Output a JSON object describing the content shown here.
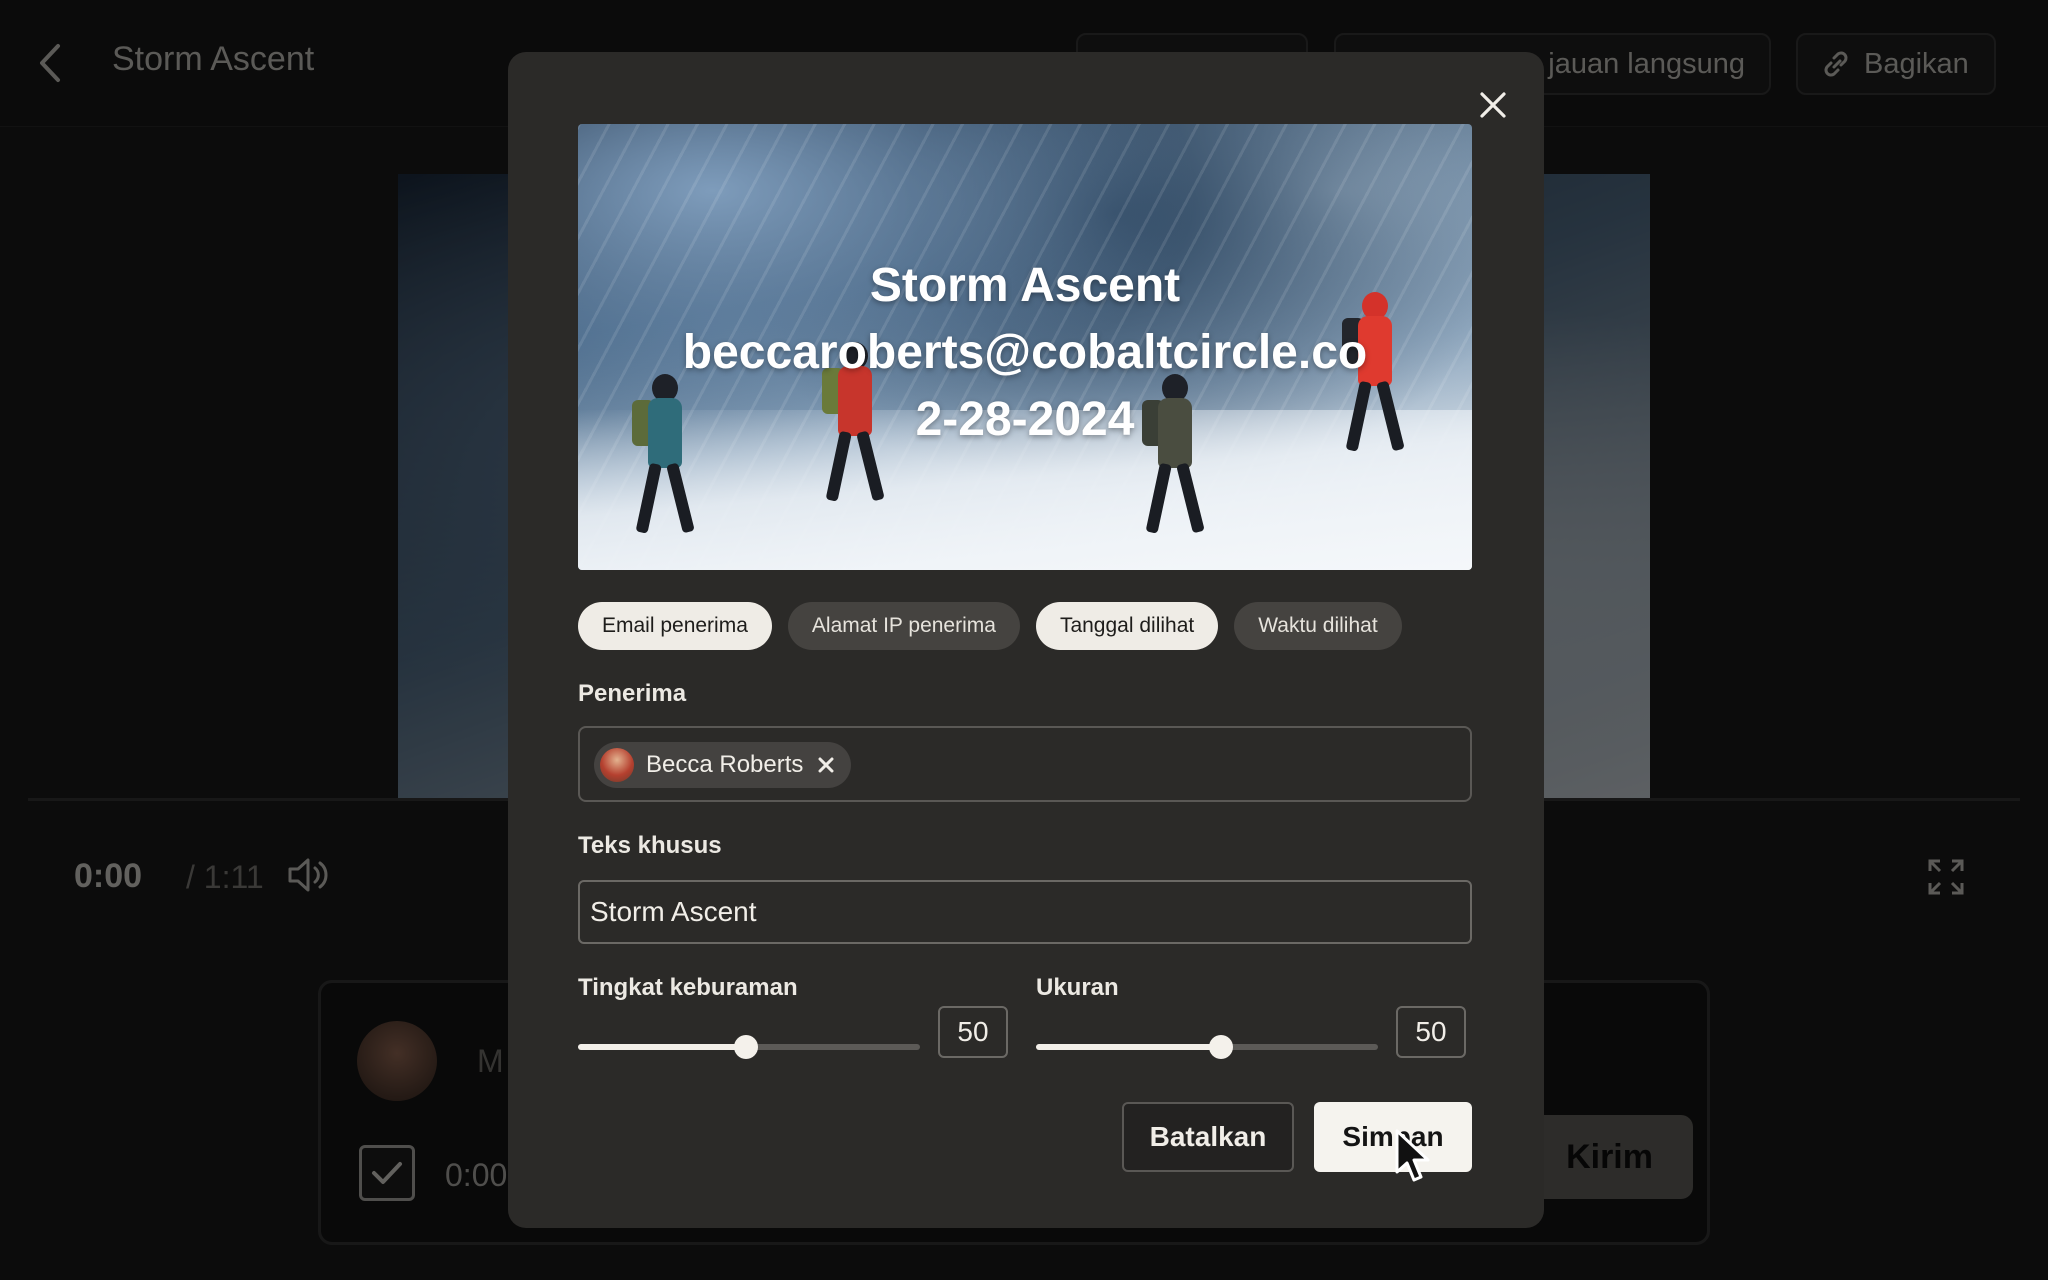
{
  "app": {
    "title": "Storm Ascent",
    "header_buttons": {
      "versions_label": "",
      "live_review_label": "jauan langsung",
      "share_label": "Bagikan"
    }
  },
  "player": {
    "time_current": "0:00",
    "time_total": "/ 1:11"
  },
  "comment": {
    "placeholder": "M",
    "timestamp": "0:00",
    "send_label": "Kirim"
  },
  "modal": {
    "preview": {
      "title": "Storm Ascent",
      "email": "beccaroberts@cobaltcircle.co",
      "date": "2-28-2024"
    },
    "chips": [
      {
        "label": "Email penerima",
        "selected": true
      },
      {
        "label": "Alamat IP penerima",
        "selected": false
      },
      {
        "label": "Tanggal dilihat",
        "selected": true
      },
      {
        "label": "Waktu dilihat",
        "selected": false
      }
    ],
    "recipient_label": "Penerima",
    "recipient_name": "Becca Roberts",
    "custom_text_label": "Teks khusus",
    "custom_text_value": "Storm Ascent",
    "blur_label": "Tingkat keburaman",
    "blur_value": "50",
    "blur_fraction": 0.49,
    "size_label": "Ukuran",
    "size_value": "50",
    "size_fraction": 0.54,
    "cancel_label": "Batalkan",
    "save_label": "Simpan"
  },
  "colors": {
    "modal_bg": "#2b2a28",
    "chip_selected": "#efece6",
    "chip_unselected": "#454340",
    "primary_button": "#f5f3ee"
  }
}
